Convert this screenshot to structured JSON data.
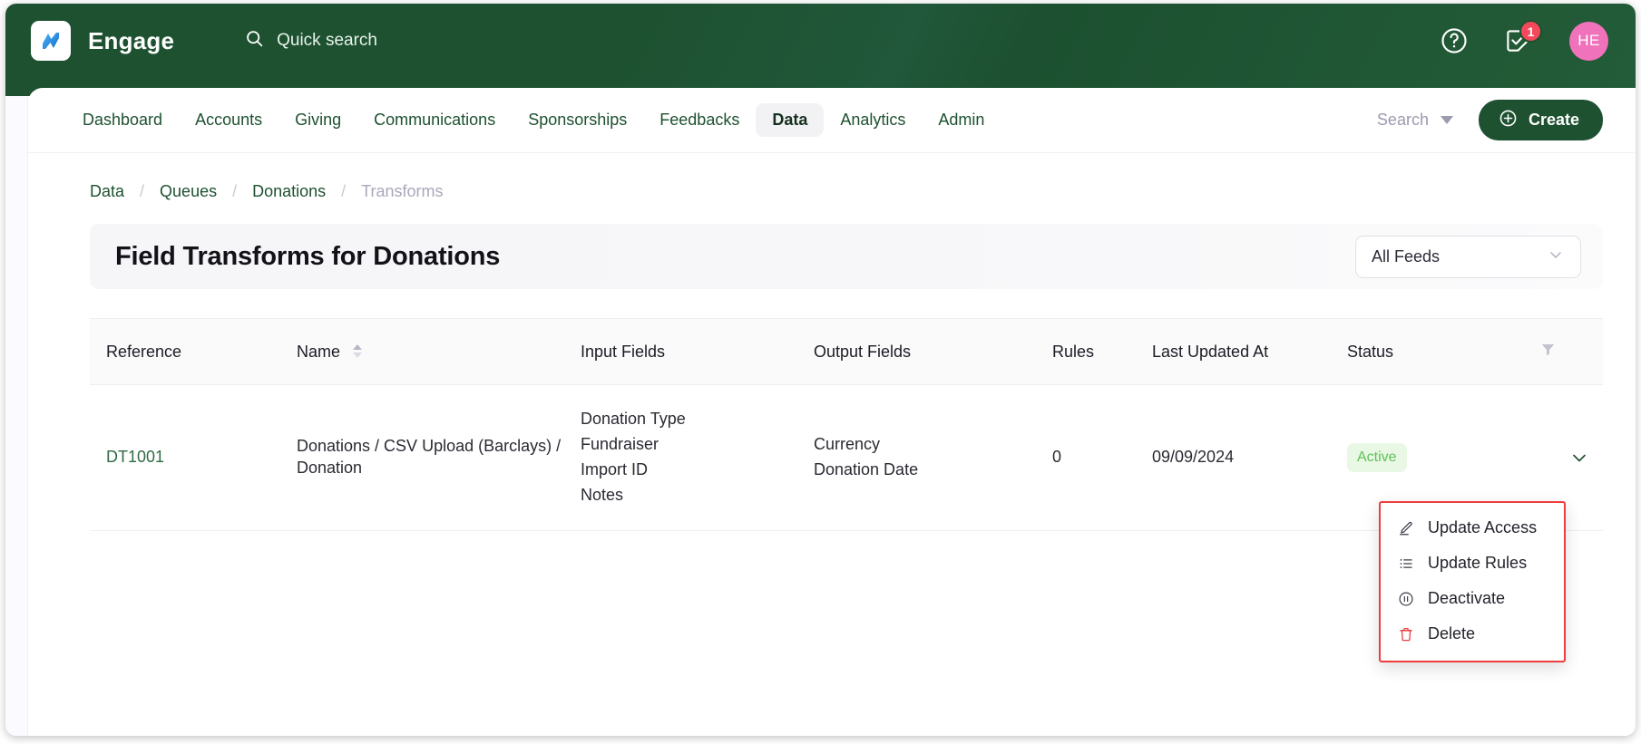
{
  "app": {
    "brand": "Engage",
    "logo_icon": "engage-logo-icon",
    "quick_search": {
      "label": "Quick search",
      "icon": "search-icon"
    },
    "help_icon": "help-circle-icon",
    "tasks": {
      "icon": "task-check-icon",
      "badge": "1"
    },
    "avatar": {
      "initials": "HE",
      "color": "#ef72bb"
    }
  },
  "nav": {
    "items": [
      {
        "label": "Dashboard",
        "active": false
      },
      {
        "label": "Accounts",
        "active": false
      },
      {
        "label": "Giving",
        "active": false
      },
      {
        "label": "Communications",
        "active": false
      },
      {
        "label": "Sponsorships",
        "active": false
      },
      {
        "label": "Feedbacks",
        "active": false
      },
      {
        "label": "Data",
        "active": true
      },
      {
        "label": "Analytics",
        "active": false
      },
      {
        "label": "Admin",
        "active": false
      }
    ],
    "search_dropdown": {
      "label": "Search",
      "icon": "chevron-down-icon"
    },
    "create_button": {
      "label": "Create",
      "icon": "plus-circle-icon"
    }
  },
  "breadcrumb": {
    "items": [
      "Data",
      "Queues",
      "Donations",
      "Transforms"
    ],
    "separator": "/"
  },
  "page": {
    "title": "Field Transforms for Donations",
    "feed_filter": {
      "value": "All Feeds",
      "icon": "chevron-down-icon"
    }
  },
  "table": {
    "columns": [
      {
        "label": "Reference",
        "sortable": false
      },
      {
        "label": "Name",
        "sortable": true
      },
      {
        "label": "Input Fields",
        "sortable": false
      },
      {
        "label": "Output Fields",
        "sortable": false
      },
      {
        "label": "Rules",
        "sortable": false
      },
      {
        "label": "Last Updated At",
        "sortable": false
      },
      {
        "label": "Status",
        "sortable": false
      }
    ],
    "filter_icon": "funnel-filter-icon",
    "rows": [
      {
        "reference": "DT1001",
        "name": "Donations / CSV Upload (Barclays) / Donation",
        "input_fields": [
          "Donation Type",
          "Fundraiser",
          "Import ID",
          "Notes"
        ],
        "output_fields": [
          "Currency",
          "Donation Date"
        ],
        "rules": "0",
        "last_updated_at": "09/09/2024",
        "status": "Active",
        "expand_icon": "chevron-down-icon"
      }
    ]
  },
  "action_menu": {
    "highlight_color": "#ef3d3d",
    "items": [
      {
        "label": "Update Access",
        "icon": "pencil-icon",
        "danger": false
      },
      {
        "label": "Update Rules",
        "icon": "list-icon",
        "danger": false
      },
      {
        "label": "Deactivate",
        "icon": "pause-circle-icon",
        "danger": false
      },
      {
        "label": "Delete",
        "icon": "trash-icon",
        "danger": true
      }
    ]
  },
  "colors": {
    "brand_green": "#1d5130",
    "link_green": "#2f6b45",
    "status_green": "#60c05a",
    "status_bg": "#e9f8e4",
    "badge_red": "#f4485b",
    "avatar_pink": "#ef72bb"
  }
}
